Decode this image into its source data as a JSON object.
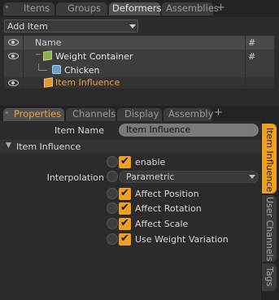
{
  "top_tabs": {
    "items": [
      {
        "label": "Items"
      },
      {
        "label": "Groups"
      },
      {
        "label": "Deformers"
      },
      {
        "label": "Assemblies"
      }
    ],
    "plus": "+"
  },
  "add_item": {
    "label": "Add Item"
  },
  "list": {
    "header_name": "Name",
    "header_hash": "#",
    "rows": [
      {
        "label": "Weight Container",
        "hash": "#"
      },
      {
        "label": "Chicken"
      },
      {
        "label": "Item Influence"
      }
    ]
  },
  "bottom_tabs": {
    "items": [
      {
        "label": "Properties"
      },
      {
        "label": "Channels"
      },
      {
        "label": "Display"
      },
      {
        "label": "Assembly"
      }
    ],
    "plus": "+"
  },
  "properties": {
    "item_name_label": "Item Name",
    "item_name_value": "Item Influence",
    "section_title": "Item Influence",
    "enable_label": "enable",
    "interpolation_label": "Interpolation",
    "interpolation_value": "Parametric",
    "checks": [
      {
        "label": "Affect Position"
      },
      {
        "label": "Affect Rotation"
      },
      {
        "label": "Affect Scale"
      },
      {
        "label": "Use Weight Variation"
      }
    ],
    "check_glyph": "✔"
  },
  "side_tabs": [
    {
      "label": "Item Influence"
    },
    {
      "label": "User Channels"
    },
    {
      "label": "Tags"
    }
  ],
  "colors": {
    "accent": "#f0a020",
    "selected_text": "#f0a040",
    "panel": "#2b2b2b"
  }
}
